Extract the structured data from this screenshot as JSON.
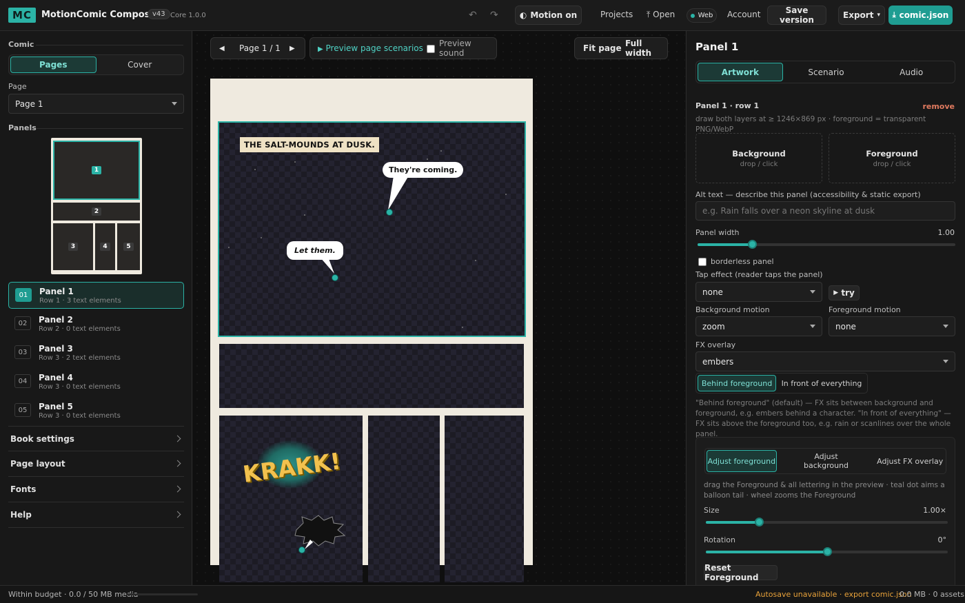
{
  "topbar": {
    "logo": "MC",
    "app_name": "MotionComic Composer",
    "version": "v43",
    "core": "Core 1.0.0",
    "motion": "Motion on",
    "projects": "Projects",
    "open": "Open",
    "web": "Web",
    "account": "Account",
    "save_version": "Save version",
    "export": "Export",
    "file": "comic.json"
  },
  "left": {
    "comic_label": "Comic",
    "tabs": [
      "Pages",
      "Cover"
    ],
    "active_tab": "Pages",
    "page_label": "Page",
    "page_value": "Page 1",
    "panels_label": "Panels",
    "thumb_numbers": [
      "1",
      "2",
      "3",
      "4",
      "5"
    ],
    "panels": [
      {
        "num": "01",
        "title": "Panel 1",
        "sub": "Row 1 · 3 text elements"
      },
      {
        "num": "02",
        "title": "Panel 2",
        "sub": "Row 2 · 0 text elements"
      },
      {
        "num": "03",
        "title": "Panel 3",
        "sub": "Row 3 · 2 text elements"
      },
      {
        "num": "04",
        "title": "Panel 4",
        "sub": "Row 3 · 0 text elements"
      },
      {
        "num": "05",
        "title": "Panel 5",
        "sub": "Row 3 · 0 text elements"
      }
    ],
    "sections": [
      "Book settings",
      "Page layout",
      "Fonts",
      "Help"
    ]
  },
  "center": {
    "page_indicator": "Page 1 / 1",
    "preview": "Preview page scenarios",
    "preview_sound": "Preview sound",
    "fit_page": "Fit page",
    "full_width": "Full width",
    "caption": "THE SALT-MOUNDS AT DUSK.",
    "bubble1": "They're coming.",
    "bubble2": "Let them.",
    "sfx": "KRAKK!"
  },
  "right": {
    "title": "Panel 1",
    "tabs": [
      "Artwork",
      "Scenario",
      "Audio"
    ],
    "active_tab": "Artwork",
    "row_label": "Panel 1 · row 1",
    "remove": "remove",
    "hint": "draw both layers at ≥ 1246×869 px · foreground = transparent PNG/WebP",
    "background": "Background",
    "foreground": "Foreground",
    "drop_click": "drop / click",
    "alt_label": "Alt text — describe this panel (accessibility & static export)",
    "alt_placeholder": "e.g. Rain falls over a neon skyline at dusk",
    "width_label": "Panel width",
    "width_value": "1.00",
    "width_level": 0.21,
    "borderless": "borderless panel",
    "tap_label": "Tap effect (reader taps the panel)",
    "tap_value": "none",
    "try": "try",
    "bg_motion_label": "Background motion",
    "bg_motion_value": "zoom",
    "fg_motion_label": "Foreground motion",
    "fg_motion_value": "none",
    "fx_label": "FX overlay",
    "fx_value": "embers",
    "fx_modes": [
      "Behind foreground",
      "In front of everything"
    ],
    "fx_help": "\"Behind foreground\" (default) — FX sits between background and foreground, e.g. embers behind a character. \"In front of everything\" — FX sits above the foreground too, e.g. rain or scanlines over the whole panel.",
    "adjust_tabs": [
      "Adjust foreground",
      "Adjust background",
      "Adjust FX overlay"
    ],
    "adjust_help": "drag the Foreground & all lettering in the preview · teal dot aims a balloon tail · wheel zooms the Foreground",
    "size_label": "Size",
    "size_value": "1.00×",
    "size_level": 0.22,
    "rotation_label": "Rotation",
    "rotation_value": "0°",
    "rotation_level": 0.5,
    "reset": "Reset Foreground"
  },
  "status": {
    "budget": "Within budget · 0.0 / 50 MB media",
    "budget_level": 0.0,
    "autosave": "Autosave unavailable · export comic.json",
    "assets": "0.0 MB · 0 assets"
  },
  "colors": {
    "accent": "#2bb3a6",
    "warning": "#e8a23a",
    "danger": "#e07a5f",
    "sfx": "#f2c14e"
  }
}
